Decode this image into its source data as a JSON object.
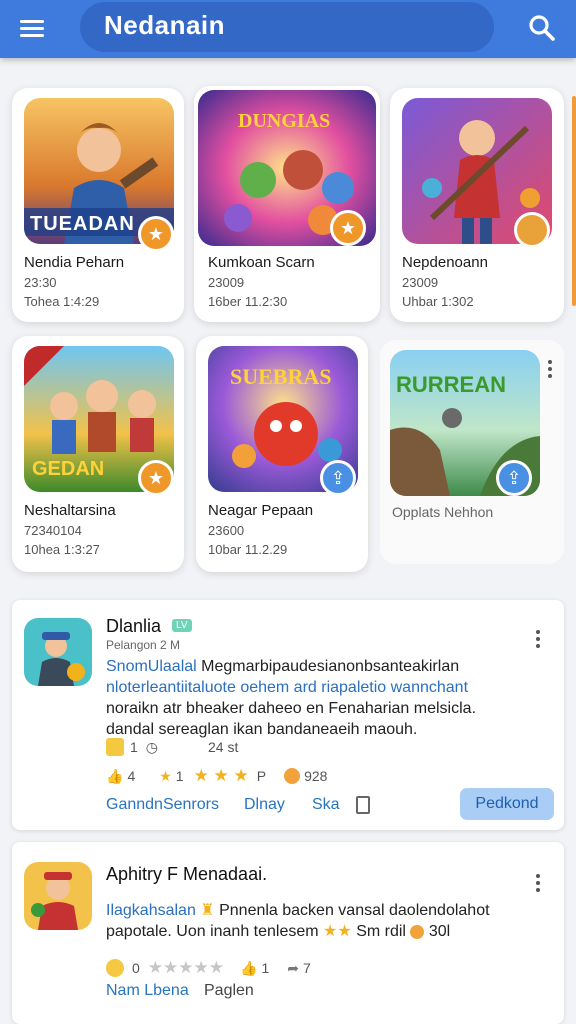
{
  "app": {
    "title": "Nedanain"
  },
  "games": [
    {
      "title": "Nendia Peharn",
      "line1": "23:30",
      "line2": "Tohea 1:4:29",
      "art": "TUEADAN"
    },
    {
      "title": "Kumkoan Scarn",
      "line1": "23009",
      "line2": "16ber 11.2:30",
      "art": "DUNGIAS"
    },
    {
      "title": "Nepdenoann",
      "line1": "23009",
      "line2": "Uhbar 1:302",
      "art": ""
    },
    {
      "title": "Neshaltarsina",
      "line1": "72340104",
      "line2": "10hea 1:3:27",
      "art": "GEDAN"
    },
    {
      "title": "Neagar Pepaan",
      "line1": "23600",
      "line2": "10bar 11.2.29",
      "art": "SUEBRAS"
    },
    {
      "title": "Opplats Nehhon",
      "line1": "",
      "line2": "",
      "art": "RURREAN"
    }
  ],
  "posts": [
    {
      "name": "Dlanlia",
      "tag": "LV",
      "sub": "Pelangon 2 M",
      "lead": "SnomUlaalal",
      "text1": " Megmarbipaudesianonbsanteakirlan",
      "text2": "nloterleantiitaluote oehem ard riapaletio wannchant",
      "text3": "noraikn atr bheaker daheeo en Fenaharian melsicla.",
      "text4": "dandal sereaglan ikan bandaneaeih maouh.",
      "react_count": "1",
      "time": "24 st",
      "likes": "4",
      "rating_left": "1",
      "rating_right": "P",
      "coins": "928",
      "link1": "GanndnSenrors",
      "link2": "Dlnay",
      "link3": "Ska",
      "button": "Pedkond"
    },
    {
      "name": "Aphitry F Menadaai.",
      "lead": "Ilagkahsalan",
      "text1": "Pnnenla backen vansal daolendolahot",
      "text2": "papotale. Uon inanh tenlesem",
      "text2b": "Sm rdil",
      "coins": "30l",
      "count_left": "0",
      "likes": "1",
      "shares": "7",
      "link1": "Nam Lbena",
      "link2": "Paglen"
    }
  ],
  "colors": {
    "topbar": "#3f7bdc",
    "accent": "#2874bf",
    "badge_orange": "#f0972a"
  },
  "icons": [
    "menu-icon",
    "search-icon",
    "star-icon",
    "upload-icon",
    "more-vert-icon",
    "thumbs-up-icon",
    "share-icon",
    "coin-icon",
    "bookmark-icon"
  ]
}
